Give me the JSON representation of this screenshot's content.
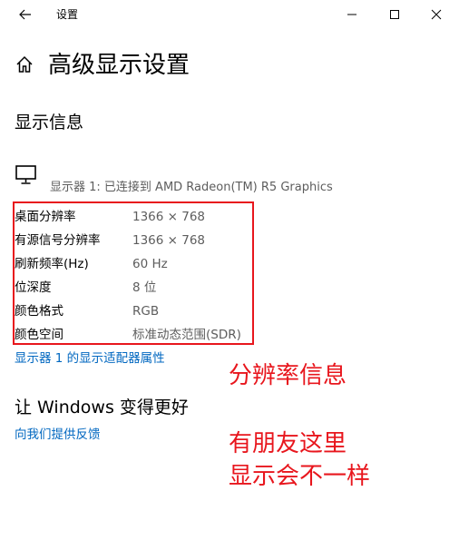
{
  "window": {
    "title": "设置",
    "controls": {
      "back_icon": "back-arrow-icon",
      "minimize_icon": "minimize-icon",
      "maximize_icon": "maximize-icon",
      "close_icon": "close-icon"
    }
  },
  "header": {
    "home_icon": "home-icon",
    "title": "高级显示设置"
  },
  "display_info": {
    "section_title": "显示信息",
    "monitor_icon": "monitor-icon",
    "monitor_caption": "显示器 1: 已连接到 AMD Radeon(TM) R5 Graphics",
    "rows": [
      {
        "label": "桌面分辨率",
        "value": "1366 × 768"
      },
      {
        "label": "有源信号分辨率",
        "value": "1366 × 768"
      },
      {
        "label": "刷新频率(Hz)",
        "value": "60 Hz"
      },
      {
        "label": "位深度",
        "value": "8 位"
      },
      {
        "label": "颜色格式",
        "value": "RGB"
      },
      {
        "label": "颜色空间",
        "value": "标准动态范围(SDR)"
      }
    ],
    "adapter_link": "显示器 1 的显示适配器属性"
  },
  "better": {
    "title": "让 Windows 变得更好",
    "feedback_link": "向我们提供反馈"
  },
  "annotations": {
    "resolution_note": "分辨率信息",
    "friend_note_line1": "有朋友这里",
    "friend_note_line2": "显示会不一样"
  },
  "colors": {
    "link": "#0067c0",
    "annotation_red": "#e8161d",
    "secondary_text": "#5d5d5d"
  }
}
